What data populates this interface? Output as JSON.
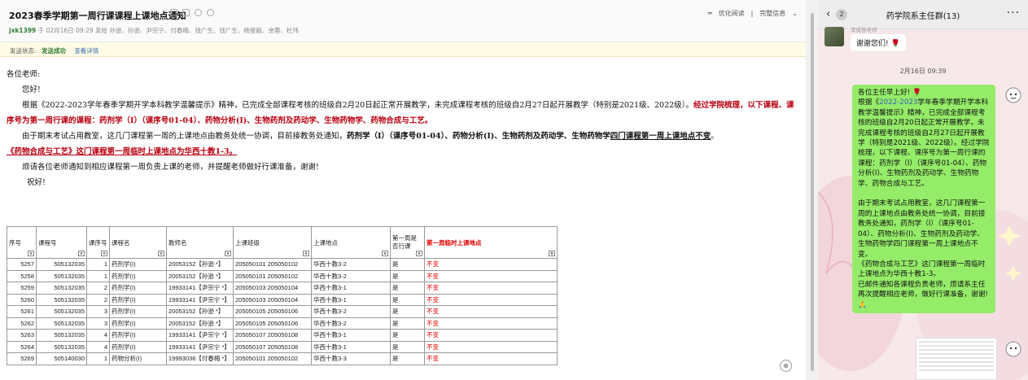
{
  "mail": {
    "subject": "2023春季学期第一周行课课程上课地点通知",
    "header_right": {
      "optimize": "优化阅读",
      "full_info": "完整信息"
    },
    "sender_name": "jxk1399",
    "sender_meta": "于 02月16日 09:29 发给 孙逊、孙逊、尹宗宁、付春梅、钱广生、钱广生、杨俊毅、余蓉、杜玮",
    "status_label": "发送状态:",
    "status_value": "发送成功",
    "status_link": "查看详情",
    "body": {
      "greeting": "各位老师:",
      "hello": "您好!",
      "p1_a": "根据《2022-2023学年春季学期开学本科教学温馨提示》精神，已完成全部课程考核的班级自2月20日起正常开展教学，未完成课程考核的班级自2月27日起开展教学（特别是2021级、2022级）。",
      "p1_b": "经过学院梳理，以下课程、课序号为第一周行课的课程：药剂学（I）（课序号01-04）、药物分析(I)、生物药剂及药动学、生物药物学、药物合成与工艺。",
      "p2_a": "由于期末考试占用教室，这几门课程第一周的上课地点由教务处统一协调，目前接教务处通知，",
      "p2_b": "药剂学（I）（课序号01-04）、药物分析(I)、生物药剂及药动学、生物药物学",
      "p2_c": "四门课程第一周上课地点不变",
      "p2_d": "。",
      "p3": "《药物合成与工艺》这门课程第一周临时上课地点为华西十教1-3。",
      "p4": "烦请各位老师通知到相应课程第一周负责上课的老师，并提醒老师做好行课准备，谢谢!",
      "closing": "祝好!"
    },
    "table": {
      "headers": [
        "序号",
        "课程号",
        "课序号",
        "课程名",
        "教师名",
        "上课班级",
        "上课地点",
        "第一周是否行课",
        "第一周临时上课地点"
      ],
      "rows": [
        [
          "5257",
          "505132035",
          "1",
          "药剂学(I)",
          "20053152【孙逊 *】",
          "205050101 205050102",
          "华西十教3-2",
          "是",
          "不变"
        ],
        [
          "5258",
          "505132035",
          "1",
          "药剂学(I)",
          "20053152【孙逊 *】",
          "205050101 205050102",
          "华西十教3-2",
          "是",
          "不变"
        ],
        [
          "5259",
          "505132035",
          "2",
          "药剂学(I)",
          "19933141【尹宗宁 *】",
          "205050103 205050104",
          "华西十教3-1",
          "是",
          "不变"
        ],
        [
          "5260",
          "505132035",
          "2",
          "药剂学(I)",
          "19933141【尹宗宁 *】",
          "205050103 205050104",
          "华西十教3-1",
          "是",
          "不变"
        ],
        [
          "5261",
          "505132035",
          "3",
          "药剂学(I)",
          "20053152【孙逊 *】",
          "205050105 205050106",
          "华西十教3-2",
          "是",
          "不变"
        ],
        [
          "5262",
          "505132035",
          "3",
          "药剂学(I)",
          "20053152【孙逊 *】",
          "205050105 205050106",
          "华西十教3-2",
          "是",
          "不变"
        ],
        [
          "5263",
          "505132035",
          "4",
          "药剂学(I)",
          "19933141【尹宗宁 *】",
          "205050107 205050108",
          "华西十教3-1",
          "是",
          "不变"
        ],
        [
          "5264",
          "505132035",
          "4",
          "药剂学(I)",
          "19933141【尹宗宁 *】",
          "205050107 205050108",
          "华西十教3-1",
          "是",
          "不变"
        ],
        [
          "5269",
          "505140030",
          "1",
          "药物分析(I)",
          "19993036【付春梅 *】",
          "205050101 205050102",
          "华西十教3-3",
          "是",
          "不变"
        ]
      ]
    }
  },
  "chat": {
    "back_count": "2",
    "title": "药学院系主任群(13)",
    "sender_name": "李成容老师",
    "incoming_msg": "谢谢您们! 🌹",
    "timestamp": "2月16日 09:39",
    "outgoing_msg_a": "各位主任早上好! 🌹\n根据《",
    "outgoing_msg_hl": "2022-2023",
    "outgoing_msg_b": "学年春季学期开学本科教学温馨提示》精神，已完成全部课程考核的班级自2月20日起正常开展教学，未完成课程考核的班级自2月27日起开展教学（特别是2021级、2022级）。经过学院梳理，以下课程、课序号为第一周行课的课程：药剂学（I）（课序号01-04）、药物分析(I)、生物药剂及药动学、生物药物学、药物合成与工艺。\n\n由于期末考试占用教室，这几门课程第一周的上课地点由教务处统一协调，目前接教务处通知，药剂学（I）（课序号01-04）、药物分析(I)、生物药剂及药动学、生物药物学四门课程第一周上课地点不变。\n《药物合成与工艺》这门课程第一周临时上课地点为华西十教1-3。\n已邮件通知各课程负责老师，烦请系主任再次提醒相应老师，做好行课准备，谢谢! 🙏"
  },
  "colors": {
    "green_bubble": "#95ec69",
    "warning_red": "#b8000f"
  }
}
